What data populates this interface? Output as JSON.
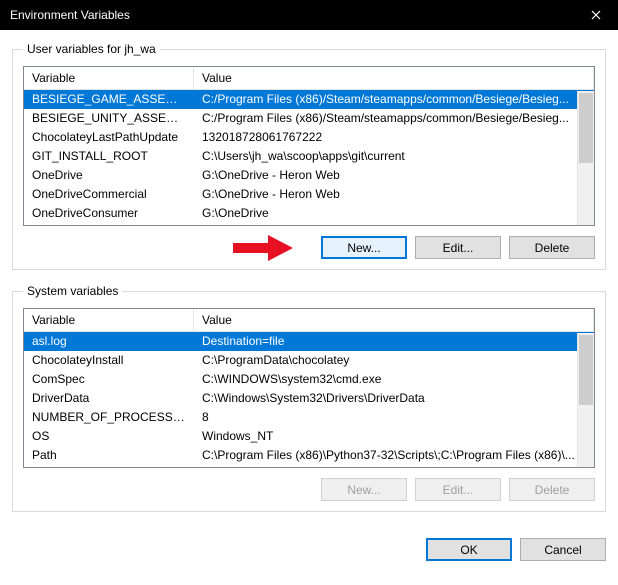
{
  "window": {
    "title": "Environment Variables"
  },
  "user_section": {
    "legend": "User variables for jh_wa",
    "header_var": "Variable",
    "header_val": "Value",
    "rows": [
      {
        "name": "BESIEGE_GAME_ASSEMBLIES",
        "value": "C:/Program Files (x86)/Steam/steamapps/common/Besiege/Besieg..."
      },
      {
        "name": "BESIEGE_UNITY_ASSEMBLIES",
        "value": "C:/Program Files (x86)/Steam/steamapps/common/Besiege/Besieg..."
      },
      {
        "name": "ChocolateyLastPathUpdate",
        "value": "132018728061767222"
      },
      {
        "name": "GIT_INSTALL_ROOT",
        "value": "C:\\Users\\jh_wa\\scoop\\apps\\git\\current"
      },
      {
        "name": "OneDrive",
        "value": "G:\\OneDrive - Heron Web"
      },
      {
        "name": "OneDriveCommercial",
        "value": "G:\\OneDrive - Heron Web"
      },
      {
        "name": "OneDriveConsumer",
        "value": "G:\\OneDrive"
      }
    ],
    "new_label": "New...",
    "edit_label": "Edit...",
    "delete_label": "Delete"
  },
  "system_section": {
    "legend": "System variables",
    "header_var": "Variable",
    "header_val": "Value",
    "rows": [
      {
        "name": "asl.log",
        "value": "Destination=file"
      },
      {
        "name": "ChocolateyInstall",
        "value": "C:\\ProgramData\\chocolatey"
      },
      {
        "name": "ComSpec",
        "value": "C:\\WINDOWS\\system32\\cmd.exe"
      },
      {
        "name": "DriverData",
        "value": "C:\\Windows\\System32\\Drivers\\DriverData"
      },
      {
        "name": "NUMBER_OF_PROCESSORS",
        "value": "8"
      },
      {
        "name": "OS",
        "value": "Windows_NT"
      },
      {
        "name": "Path",
        "value": "C:\\Program Files (x86)\\Python37-32\\Scripts\\;C:\\Program Files (x86)\\..."
      }
    ],
    "new_label": "New...",
    "edit_label": "Edit...",
    "delete_label": "Delete"
  },
  "footer": {
    "ok_label": "OK",
    "cancel_label": "Cancel"
  }
}
